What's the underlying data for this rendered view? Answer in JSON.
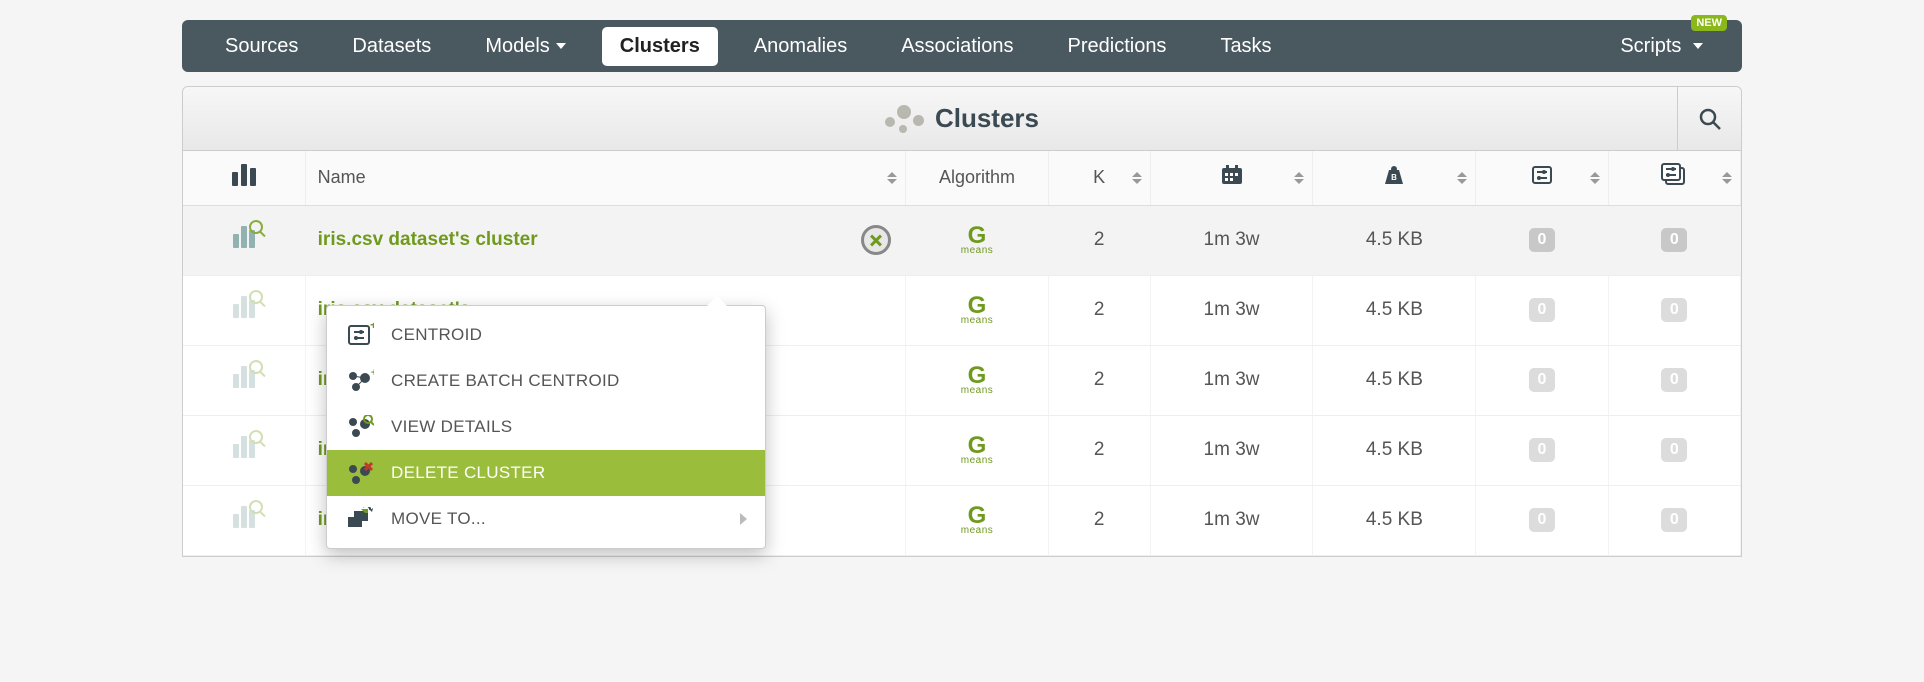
{
  "nav": {
    "items": [
      "Sources",
      "Datasets",
      "Models",
      "Clusters",
      "Anomalies",
      "Associations",
      "Predictions",
      "Tasks"
    ],
    "active": "Clusters",
    "scripts": "Scripts",
    "new_badge": "NEW"
  },
  "panel": {
    "title": "Clusters"
  },
  "columns": {
    "name": "Name",
    "algorithm": "Algorithm",
    "k": "K"
  },
  "rows": [
    {
      "name": "iris.csv dataset's cluster",
      "algorithm": "G-means",
      "k": "2",
      "age": "1m 3w",
      "size": "4.5 KB",
      "c1": "0",
      "c2": "0",
      "selected": true
    },
    {
      "name": "iris.csv dataset's",
      "algorithm": "G-means",
      "k": "2",
      "age": "1m 3w",
      "size": "4.5 KB",
      "c1": "0",
      "c2": "0"
    },
    {
      "name": "iris.csv dataset's",
      "algorithm": "G-means",
      "k": "2",
      "age": "1m 3w",
      "size": "4.5 KB",
      "c1": "0",
      "c2": "0"
    },
    {
      "name": "iris.csv dataset's",
      "algorithm": "G-means",
      "k": "2",
      "age": "1m 3w",
      "size": "4.5 KB",
      "c1": "0",
      "c2": "0"
    },
    {
      "name": "iris.csv dataset's",
      "algorithm": "G-means",
      "k": "2",
      "age": "1m 3w",
      "size": "4.5 KB",
      "c1": "0",
      "c2": "0"
    }
  ],
  "menu": {
    "centroid": "CENTROID",
    "batch": "CREATE BATCH CENTROID",
    "view": "VIEW DETAILS",
    "delete": "DELETE CLUSTER",
    "move": "MOVE TO..."
  },
  "gmeans": {
    "g": "G",
    "sub": "means"
  }
}
